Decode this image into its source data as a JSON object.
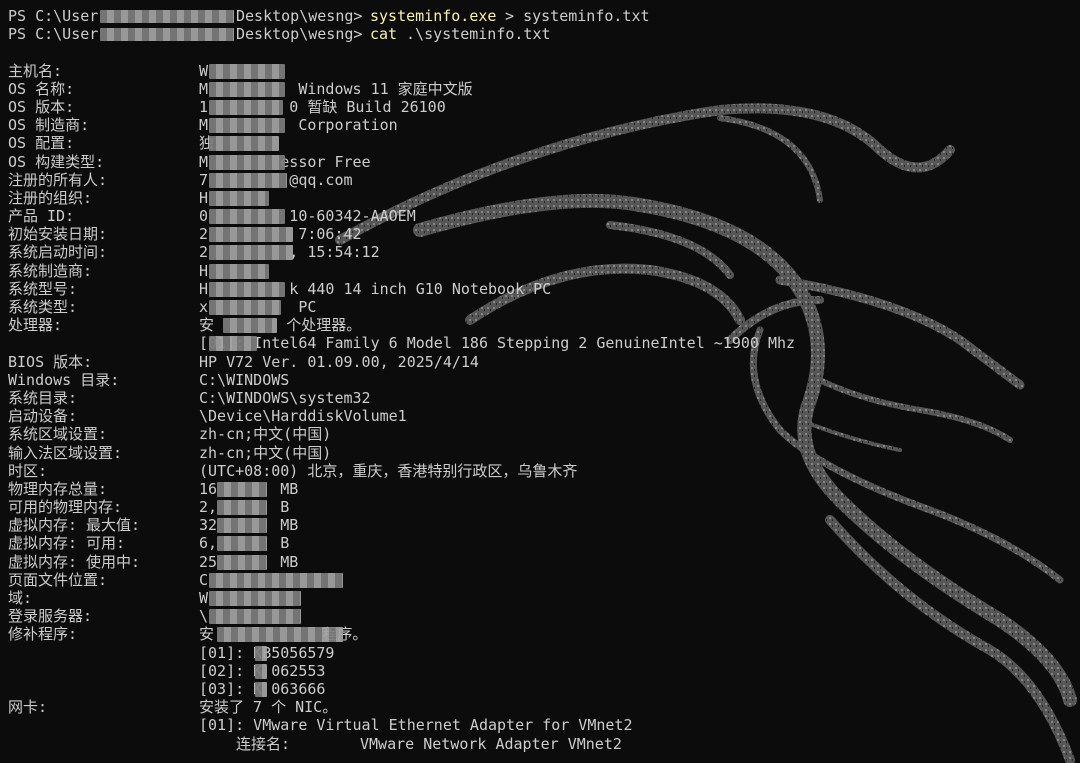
{
  "prompt": {
    "line1_prefix": "PS C:\\User",
    "line1_suffix": "Desktop\\wesng> ",
    "line1_cmd": "systeminfo.exe",
    "line1_args": " > systeminfo.txt",
    "line2_prefix": "PS C:\\User",
    "line2_suffix": "Desktop\\wesng> ",
    "line2_cmd": "cat",
    "line2_args": " .\\systeminfo.txt"
  },
  "rows": [
    {
      "k": "主机名:",
      "v": "W"
    },
    {
      "k": "OS 名称:",
      "v": "M          Windows 11 家庭中文版"
    },
    {
      "k": "OS 版本:",
      "v": "1         0 暂缺 Build 26100"
    },
    {
      "k": "OS 制造商:",
      "v": "M          Corporation"
    },
    {
      "k": "OS 配置:",
      "v": "独"
    },
    {
      "k": "OS 构建类型:",
      "v": "M        essor Free"
    },
    {
      "k": "注册的所有人:",
      "v": "7         @qq.com"
    },
    {
      "k": "注册的组织:",
      "v": "H"
    },
    {
      "k": "产品 ID:",
      "v": "0         10-60342-AAOEM"
    },
    {
      "k": "初始安装日期:",
      "v": "2          7:06:42"
    },
    {
      "k": "系统启动时间:",
      "v": "2         , 15:54:12"
    },
    {
      "k": "系统制造商:",
      "v": "H"
    },
    {
      "k": "系统型号:",
      "v": "H         k 440 14 inch G10 Notebook PC"
    },
    {
      "k": "系统类型:",
      "v": "x          PC"
    },
    {
      "k": "处理器:",
      "v": "安        个处理器。"
    },
    {
      "k": "",
      "v": "[01]: Intel64 Family 6 Model 186 Stepping 2 GenuineIntel ~1900 Mhz"
    },
    {
      "k": "BIOS 版本:",
      "v": "HP V72 Ver. 01.09.00, 2025/4/14"
    },
    {
      "k": "Windows 目录:",
      "v": "C:\\WINDOWS"
    },
    {
      "k": "系统目录:",
      "v": "C:\\WINDOWS\\system32"
    },
    {
      "k": "启动设备:",
      "v": "\\Device\\HarddiskVolume1"
    },
    {
      "k": "系统区域设置:",
      "v": "zh-cn;中文(中国)"
    },
    {
      "k": "输入法区域设置:",
      "v": "zh-cn;中文(中国)"
    },
    {
      "k": "时区:",
      "v": "(UTC+08:00) 北京，重庆，香港特别行政区，乌鲁木齐"
    },
    {
      "k": "物理内存总量:",
      "v": "16       MB"
    },
    {
      "k": "可用的物理内存:",
      "v": "2,       B"
    },
    {
      "k": "虚拟内存: 最大值:",
      "v": "32       MB"
    },
    {
      "k": "虚拟内存: 可用:",
      "v": "6,       B"
    },
    {
      "k": "虚拟内存: 使用中:",
      "v": "25       MB"
    },
    {
      "k": "页面文件位置:",
      "v": "C"
    },
    {
      "k": "域:",
      "v": "W"
    },
    {
      "k": "登录服务器:",
      "v": "\\"
    },
    {
      "k": "修补程序:",
      "v": "安            程序。"
    },
    {
      "k": "",
      "v": "[01]: KB5056579"
    },
    {
      "k": "",
      "v": "[02]: K 062553"
    },
    {
      "k": "",
      "v": "[03]: K 063666"
    },
    {
      "k": "网卡:",
      "v": "安装了 7 个 NIC。"
    },
    {
      "k": "",
      "v": "[01]: VMware Virtual Ethernet Adapter for VMnet2"
    },
    {
      "k": "",
      "v": "连接名:",
      "v3": "VMware Network Adapter VMnet2",
      "sub": true
    }
  ],
  "colors": {
    "background": "#0c0c0c",
    "text": "#cccccc",
    "command": "#f9f1a5",
    "watermark": "#6e6e6e"
  }
}
